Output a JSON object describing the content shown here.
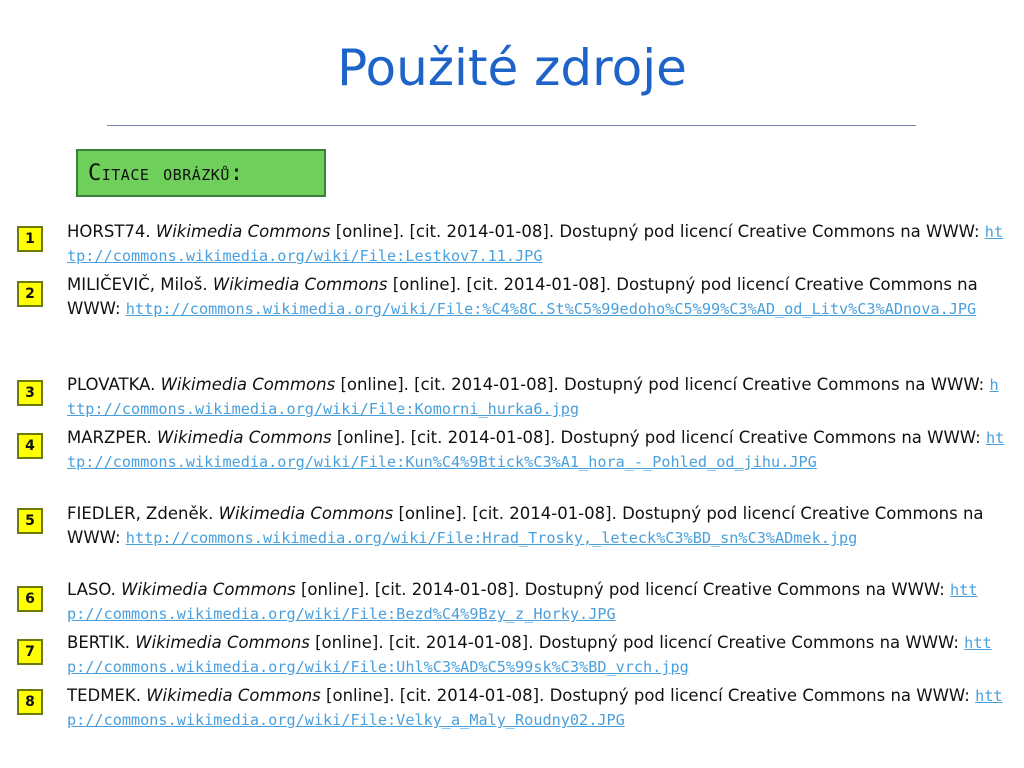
{
  "title": "Použité zdroje",
  "section_label": "Citace obrázků:",
  "colors": {
    "title": "#1e63c8",
    "section_bg": "#6ecf5a",
    "badge_bg": "#ffff00",
    "link": "#4aa0dd"
  },
  "refs": [
    {
      "num": "1",
      "author": "HORST74.",
      "work": "Wikimedia Commons",
      "rest": "[online]. [cit. 2014-01-08]. Dostupný pod licencí Creative Commons na WWW:",
      "url": "http://commons.wikimedia.org/wiki/File:Lestkov7.11.JPG"
    },
    {
      "num": "2",
      "author": "MILIČEVIČ, Miloš.",
      "work": "Wikimedia Commons",
      "rest": "[online]. [cit. 2014-01-08]. Dostupný pod licencí Creative Commons na WWW:",
      "url": "http://commons.wikimedia.org/wiki/File:%C4%8C.St%C5%99edoho%C5%99%C3%AD_od_Litv%C3%ADnova.JPG"
    },
    {
      "num": "3",
      "author": "PLOVATKA.",
      "work": "Wikimedia Commons",
      "rest": "[online]. [cit. 2014-01-08]. Dostupný pod licencí Creative Commons na WWW:",
      "url": "http://commons.wikimedia.org/wiki/File:Komorni_hurka6.jpg"
    },
    {
      "num": "4",
      "author": "MARZPER.",
      "work": "Wikimedia Commons",
      "rest": "[online]. [cit. 2014-01-08]. Dostupný pod licencí Creative Commons na WWW:",
      "url": "http://commons.wikimedia.org/wiki/File:Kun%C4%9Btick%C3%A1_hora_-_Pohled_od_jihu.JPG"
    },
    {
      "num": "5",
      "author": "FIEDLER, Zdeněk.",
      "work": "Wikimedia Commons",
      "rest": "[online]. [cit. 2014-01-08]. Dostupný pod licencí Creative Commons na WWW:",
      "url": "http://commons.wikimedia.org/wiki/File:Hrad_Trosky,_leteck%C3%BD_sn%C3%ADmek.jpg"
    },
    {
      "num": "6",
      "author": "LASO.",
      "work": "Wikimedia Commons",
      "rest": "[online]. [cit. 2014-01-08]. Dostupný pod licencí Creative Commons na WWW:",
      "url": "http://commons.wikimedia.org/wiki/File:Bezd%C4%9Bzy_z_Horky.JPG"
    },
    {
      "num": "7",
      "author": "BERTIK.",
      "work": "Wikimedia Commons",
      "rest": "[online]. [cit. 2014-01-08]. Dostupný pod licencí Creative Commons na WWW:",
      "url": "http://commons.wikimedia.org/wiki/File:Uhl%C3%AD%C5%99sk%C3%BD_vrch.jpg"
    },
    {
      "num": "8",
      "author": "TEDMEK.",
      "work": "Wikimedia Commons",
      "rest": "[online]. [cit. 2014-01-08]. Dostupný pod licencí Creative Commons na WWW:",
      "url": "http://commons.wikimedia.org/wiki/File:Velky_a_Maly_Roudny02.JPG"
    }
  ]
}
